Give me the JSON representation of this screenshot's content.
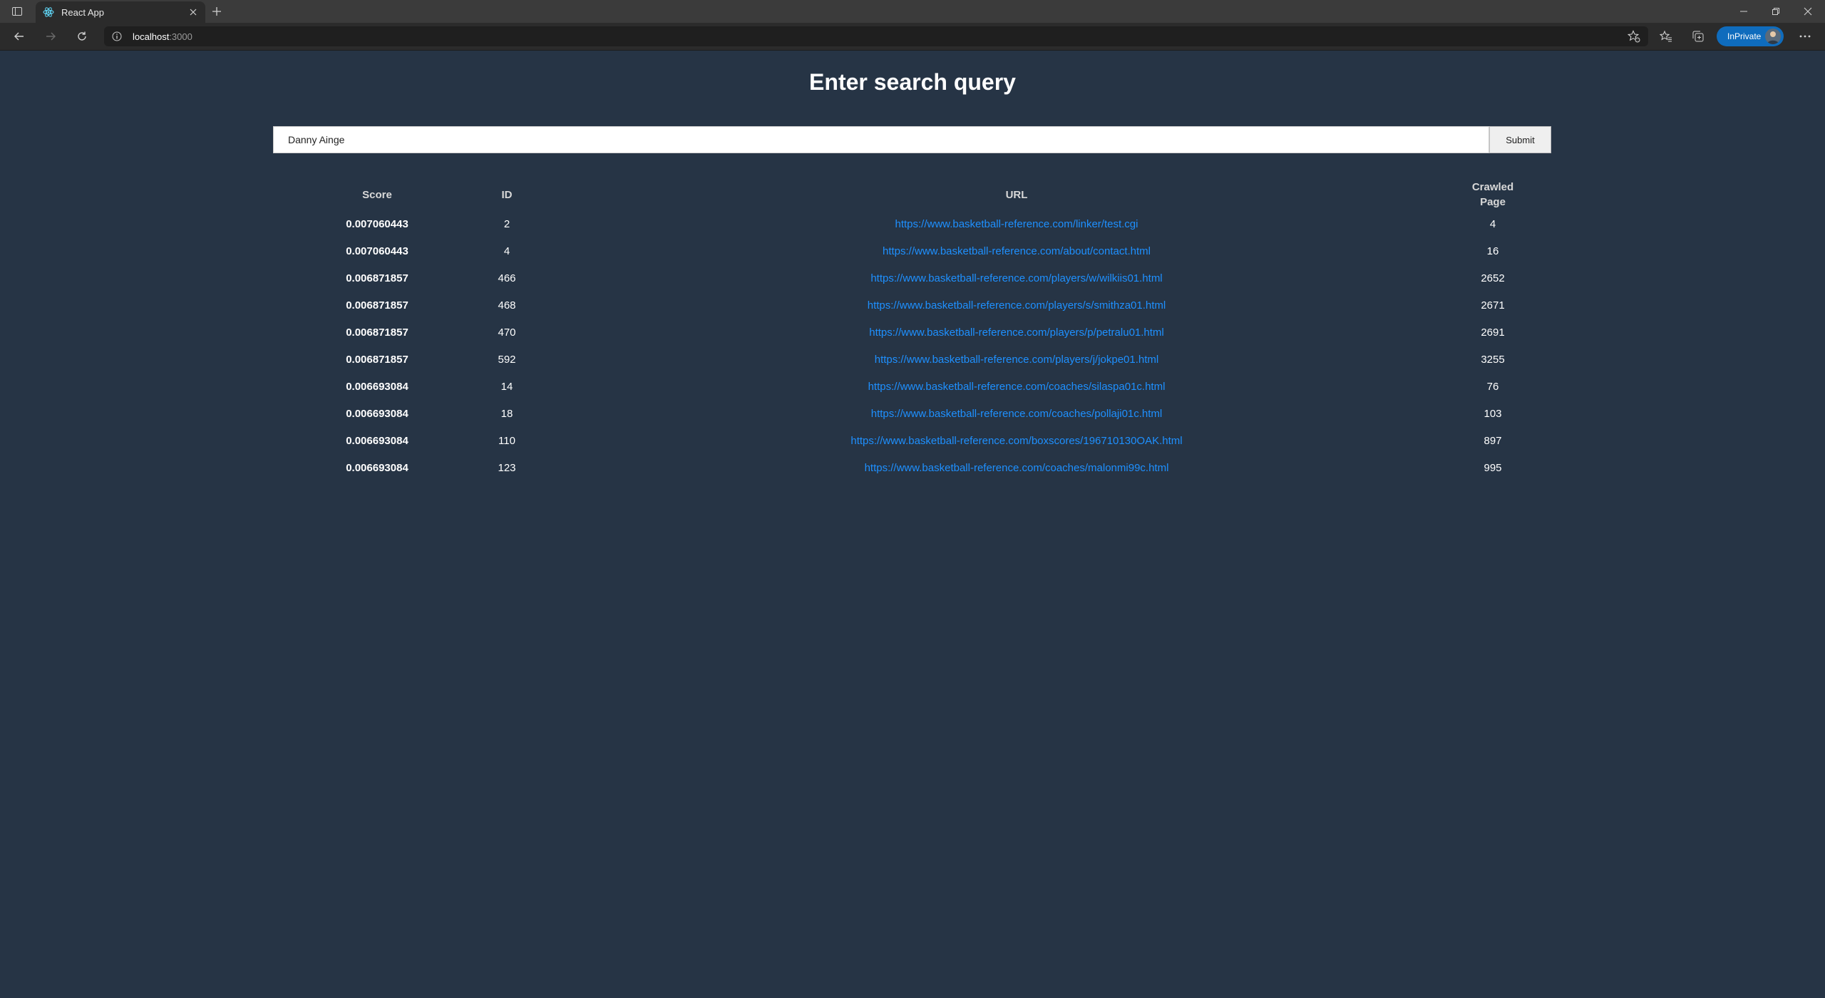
{
  "browser": {
    "tab_title": "React App",
    "address": {
      "host": "localhost",
      "port": ":3000"
    },
    "inprivate_label": "InPrivate"
  },
  "page": {
    "title": "Enter search query",
    "search": {
      "value": "Danny Ainge",
      "placeholder": ""
    },
    "submit_label": "Submit"
  },
  "table": {
    "headers": {
      "score": "Score",
      "id": "ID",
      "url": "URL",
      "crawled_page": "Crawled Page"
    },
    "rows": [
      {
        "score": "0.007060443",
        "id": "2",
        "url": "https://www.basketball-reference.com/linker/test.cgi",
        "crawled_page": "4"
      },
      {
        "score": "0.007060443",
        "id": "4",
        "url": "https://www.basketball-reference.com/about/contact.html",
        "crawled_page": "16"
      },
      {
        "score": "0.006871857",
        "id": "466",
        "url": "https://www.basketball-reference.com/players/w/wilkiis01.html",
        "crawled_page": "2652"
      },
      {
        "score": "0.006871857",
        "id": "468",
        "url": "https://www.basketball-reference.com/players/s/smithza01.html",
        "crawled_page": "2671"
      },
      {
        "score": "0.006871857",
        "id": "470",
        "url": "https://www.basketball-reference.com/players/p/petralu01.html",
        "crawled_page": "2691"
      },
      {
        "score": "0.006871857",
        "id": "592",
        "url": "https://www.basketball-reference.com/players/j/jokpe01.html",
        "crawled_page": "3255"
      },
      {
        "score": "0.006693084",
        "id": "14",
        "url": "https://www.basketball-reference.com/coaches/silaspa01c.html",
        "crawled_page": "76"
      },
      {
        "score": "0.006693084",
        "id": "18",
        "url": "https://www.basketball-reference.com/coaches/pollaji01c.html",
        "crawled_page": "103"
      },
      {
        "score": "0.006693084",
        "id": "110",
        "url": "https://www.basketball-reference.com/boxscores/196710130OAK.html",
        "crawled_page": "897"
      },
      {
        "score": "0.006693084",
        "id": "123",
        "url": "https://www.basketball-reference.com/coaches/malonmi99c.html",
        "crawled_page": "995"
      }
    ]
  },
  "colors": {
    "page_background": "#263445",
    "link": "#1e90ff",
    "inprivate_badge": "#0f6cbd"
  },
  "icons": [
    "tab-actions-icon",
    "react-favicon-icon",
    "close-icon",
    "plus-icon",
    "minimize-icon",
    "restore-icon",
    "back-icon",
    "forward-icon",
    "refresh-icon",
    "info-icon",
    "favorite-add-icon",
    "favorites-icon",
    "collections-icon",
    "more-icon"
  ]
}
